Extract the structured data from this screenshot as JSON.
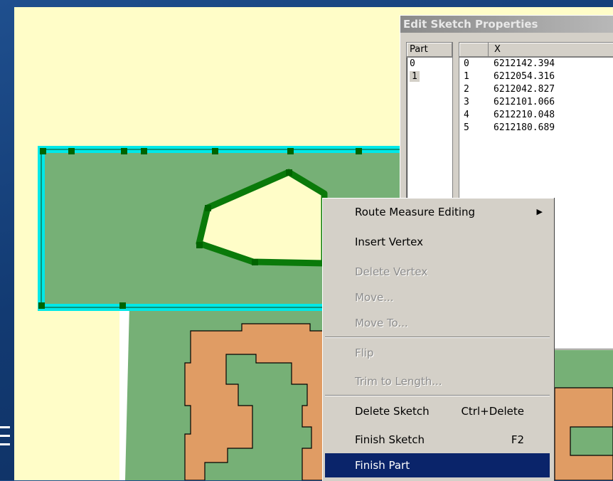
{
  "dialog": {
    "title": "Edit Sketch Properties",
    "part_header": "Part",
    "parts": [
      "0",
      "1"
    ],
    "selected_part": "1",
    "columns": [
      "",
      "X"
    ],
    "points": [
      {
        "index": "0",
        "x": "6212142.394"
      },
      {
        "index": "1",
        "x": "6212054.316"
      },
      {
        "index": "2",
        "x": "6212042.827"
      },
      {
        "index": "3",
        "x": "6212101.066"
      },
      {
        "index": "4",
        "x": "6212210.048"
      },
      {
        "index": "5",
        "x": "6212180.689"
      }
    ]
  },
  "context_menu": {
    "items": [
      {
        "label": "Route Measure Editing",
        "enabled": true,
        "submenu": true
      },
      {
        "label": "Insert Vertex",
        "enabled": true
      },
      {
        "label": "Delete Vertex",
        "enabled": false
      },
      {
        "label": "Move...",
        "enabled": false
      },
      {
        "label": "Move To...",
        "enabled": false
      },
      {
        "label": "Flip",
        "enabled": false
      },
      {
        "label": "Trim to Length...",
        "enabled": false
      },
      {
        "label": "Delete Sketch",
        "shortcut": "Ctrl+Delete",
        "enabled": true
      },
      {
        "label": "Finish Sketch",
        "shortcut": "F2",
        "enabled": true
      },
      {
        "label": "Finish Part",
        "enabled": true,
        "highlighted": true
      }
    ]
  },
  "colors": {
    "map_background": "#fffdc8",
    "polygon_fill": "#76b076",
    "parcel_fill": "#e09c64",
    "sketch_outline": "#00e8e8",
    "vertex": "#006400",
    "menu_highlight": "#0a246a"
  }
}
